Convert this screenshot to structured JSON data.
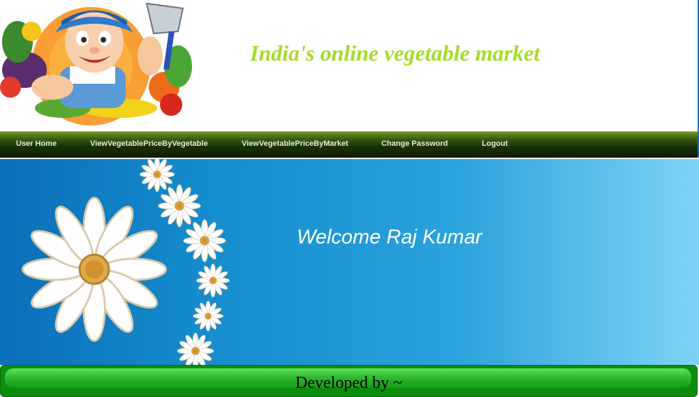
{
  "header": {
    "site_title": "India's online vegetable market",
    "logo_icon": "vegetable-farmer-mascot-icon"
  },
  "nav": {
    "items": [
      {
        "label": "User Home"
      },
      {
        "label": "ViewVegetablePriceByVegetable"
      },
      {
        "label": "ViewVegetablePriceByMarket"
      },
      {
        "label": "Change Password"
      },
      {
        "label": "Logout"
      }
    ]
  },
  "banner": {
    "welcome_text": "Welcome Raj Kumar",
    "decoration_icon": "daisy-flowers-icon"
  },
  "footer": {
    "text": "Developed by ~"
  },
  "colors": {
    "title": "#a6dc2a",
    "nav_bg": "#1a3206",
    "banner_start": "#0a6fb9",
    "banner_end": "#7fd3f5",
    "footer_bg": "#0d8d0d"
  }
}
